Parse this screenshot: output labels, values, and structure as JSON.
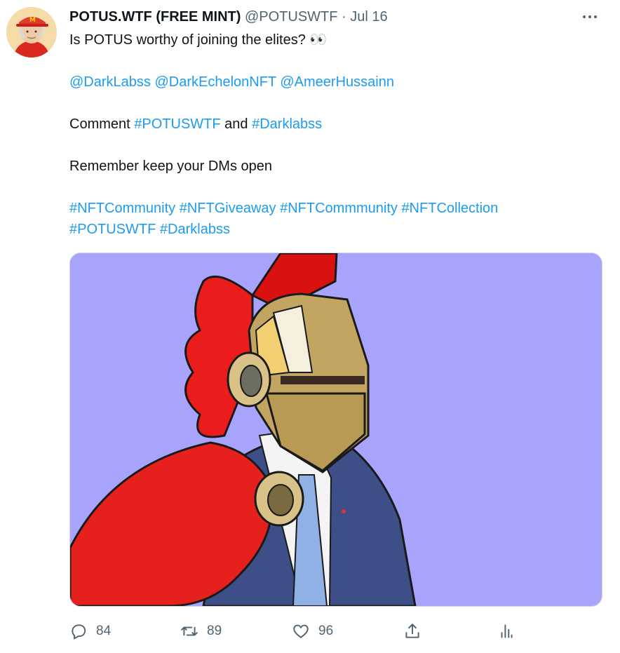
{
  "author": {
    "name": "POTUS.WTF (FREE MINT)",
    "handle": "@POTUSWTF",
    "separator": "·",
    "date": "Jul 16"
  },
  "tweet": {
    "line1": "Is POTUS worthy of joining the elites? 👀",
    "mentions": [
      "@DarkLabss",
      "@DarkEchelonNFT",
      "@AmeerHussainn"
    ],
    "comment_prefix": "Comment",
    "comment_tag1": "#POTUSWTF",
    "comment_and": "and",
    "comment_tag2": "#Darklabss",
    "line4": "Remember keep your DMs open",
    "hashtags_row1": [
      "#NFTCommunity",
      "#NFTGiveaway",
      "#NFTCommmunity",
      "#NFTCollection"
    ],
    "hashtags_row2": [
      "#POTUSWTF",
      "#Darklabss"
    ]
  },
  "actions": {
    "reply_count": "84",
    "retweet_count": "89",
    "like_count": "96"
  },
  "icons": [
    "more-icon",
    "reply-icon",
    "retweet-icon",
    "like-icon",
    "share-icon",
    "analytics-icon"
  ],
  "colors": {
    "link": "#1d9bf0",
    "secondary": "#536471",
    "media_bg": "#a9a4fb"
  }
}
